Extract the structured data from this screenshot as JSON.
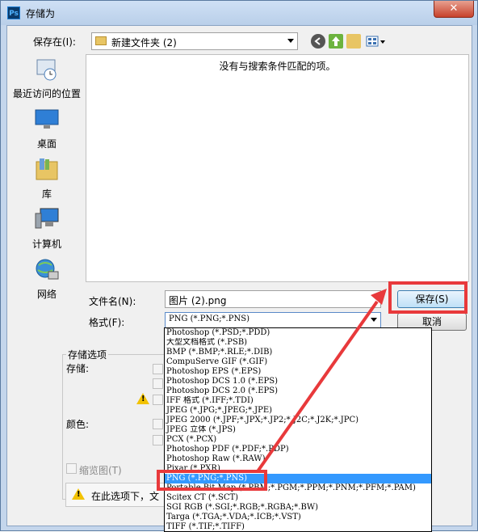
{
  "window": {
    "title": "存储为",
    "app_icon": "Ps",
    "close": "✕"
  },
  "save_in": {
    "label": "保存在(I):",
    "value": "新建文件夹 (2)"
  },
  "places": [
    {
      "label": "最近访问的位置",
      "icon": "recent-places-icon"
    },
    {
      "label": "桌面",
      "icon": "desktop-icon"
    },
    {
      "label": "库",
      "icon": "libraries-icon"
    },
    {
      "label": "计算机",
      "icon": "computer-icon"
    },
    {
      "label": "网络",
      "icon": "network-icon"
    }
  ],
  "file_list": {
    "empty_message": "没有与搜索条件匹配的项。"
  },
  "filename": {
    "label": "文件名(N):",
    "value": "图片 (2).png"
  },
  "format": {
    "label": "格式(F):",
    "value": "PNG (*.PNG;*.PNS)"
  },
  "buttons": {
    "save": "保存(S)",
    "cancel": "取消"
  },
  "options": {
    "group_title": "存储选项",
    "save_label": "存储:",
    "color_label": "颜色:",
    "thumbnail_label": "缩览图(T)",
    "warning_text": "在此选项下，文"
  },
  "format_options": [
    "Photoshop (*.PSD;*.PDD)",
    "大型文档格式 (*.PSB)",
    "BMP (*.BMP;*.RLE;*.DIB)",
    "CompuServe GIF (*.GIF)",
    "Photoshop EPS (*.EPS)",
    "Photoshop DCS 1.0 (*.EPS)",
    "Photoshop DCS 2.0 (*.EPS)",
    "IFF 格式 (*.IFF;*.TDI)",
    "JPEG (*.JPG;*.JPEG;*.JPE)",
    "JPEG 2000 (*.JPF;*.JPX;*.JP2;*.J2C;*.J2K;*.JPC)",
    "JPEG 立体 (*.JPS)",
    "PCX (*.PCX)",
    "Photoshop PDF (*.PDF;*.PDP)",
    "Photoshop Raw (*.RAW)",
    "Pixar (*.PXR)",
    "PNG (*.PNG;*.PNS)",
    "Portable Bit Map (*.PBM;*.PGM;*.PPM;*.PNM;*.PFM;*.PAM)",
    "Scitex CT (*.SCT)",
    "SGI RGB (*.SGI;*.RGB;*.RGBA;*.BW)",
    "Targa (*.TGA;*.VDA;*.ICB;*.VST)",
    "TIFF (*.TIF;*.TIFF)"
  ],
  "selected_format_index": 15,
  "colors": {
    "highlight": "#e8393b",
    "selection": "#3399ff"
  }
}
